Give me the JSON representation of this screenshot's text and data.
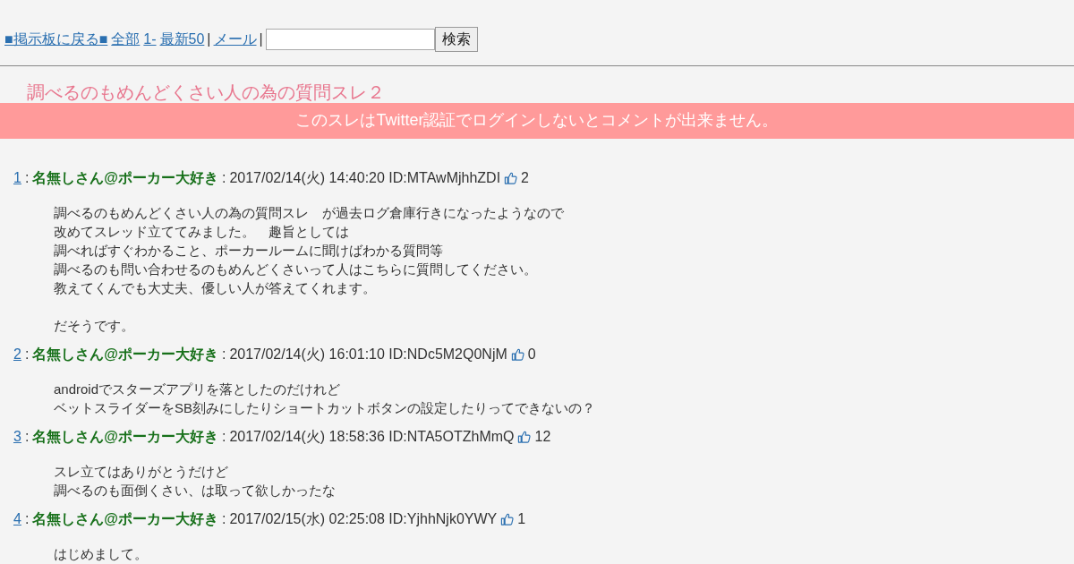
{
  "nav": {
    "links": [
      "■掲示板に戻る■",
      "全部",
      "1-",
      "最新50"
    ],
    "separator": "|",
    "mail_link": "メール",
    "search_button": "検索"
  },
  "thread_title": "調べるのもめんどくさい人の為の質問スレ２",
  "notice": "このスレはTwitter認証でログインしないとコメントが出来ません。",
  "posts": [
    {
      "number": "1",
      "colon": ":",
      "name": "名無しさん@ポーカー大好き",
      "date": "2017/02/14(火) 14:40:20",
      "id": "ID:MTAwMjhhZDI",
      "likes": "2",
      "paragraphs": [
        [
          "調べるのもめんどくさい人の為の質問スレ　が過去ログ倉庫行きになったようなので",
          "改めてスレッド立ててみました。　趣旨としては",
          "調べればすぐわかること、ポーカールームに聞けばわかる質問等",
          "調べるのも問い合わせるのもめんどくさいって人はこちらに質問してください。",
          "教えてくんでも大丈夫、優しい人が答えてくれます。"
        ],
        [
          "だそうです。"
        ]
      ]
    },
    {
      "number": "2",
      "colon": ":",
      "name": "名無しさん@ポーカー大好き",
      "date": "2017/02/14(火) 16:01:10",
      "id": "ID:NDc5M2Q0NjM",
      "likes": "0",
      "paragraphs": [
        [
          "androidでスターズアプリを落としたのだけれど",
          "ベットスライダーをSB刻みにしたりショートカットボタンの設定したりってできないの？"
        ]
      ]
    },
    {
      "number": "3",
      "colon": ":",
      "name": "名無しさん@ポーカー大好き",
      "date": "2017/02/14(火) 18:58:36",
      "id": "ID:NTA5OTZhMmQ",
      "likes": "12",
      "paragraphs": [
        [
          "スレ立てはありがとうだけど",
          "調べるのも面倒くさい、は取って欲しかったな"
        ]
      ]
    },
    {
      "number": "4",
      "colon": ":",
      "name": "名無しさん@ポーカー大好き",
      "date": "2017/02/15(水) 02:25:08",
      "id": "ID:YjhhNjk0YWY",
      "likes": "1",
      "paragraphs": [
        [
          "はじめまして。"
        ]
      ]
    }
  ]
}
